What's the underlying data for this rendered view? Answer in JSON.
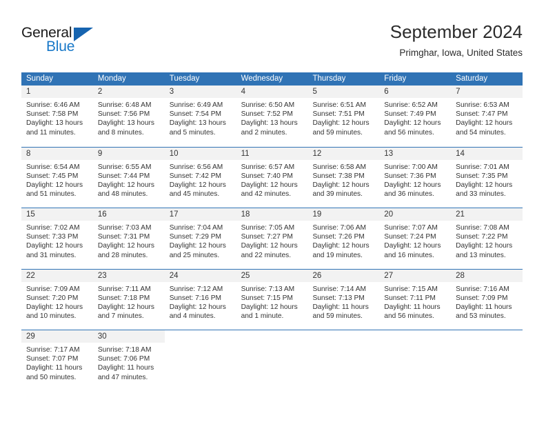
{
  "brand": {
    "name_line1": "General",
    "name_line2": "Blue",
    "triangle_color": "#1664b0",
    "blue_text_color": "#1878c8"
  },
  "header": {
    "title": "September 2024",
    "subtitle": "Primghar, Iowa, United States"
  },
  "theme": {
    "header_blue": "#3073b5",
    "daynum_band": "#f2f2f2",
    "text": "#333333"
  },
  "weekdays": [
    "Sunday",
    "Monday",
    "Tuesday",
    "Wednesday",
    "Thursday",
    "Friday",
    "Saturday"
  ],
  "weeks": [
    [
      {
        "day": "1",
        "sunrise": "Sunrise: 6:46 AM",
        "sunset": "Sunset: 7:58 PM",
        "daylight1": "Daylight: 13 hours",
        "daylight2": "and 11 minutes."
      },
      {
        "day": "2",
        "sunrise": "Sunrise: 6:48 AM",
        "sunset": "Sunset: 7:56 PM",
        "daylight1": "Daylight: 13 hours",
        "daylight2": "and 8 minutes."
      },
      {
        "day": "3",
        "sunrise": "Sunrise: 6:49 AM",
        "sunset": "Sunset: 7:54 PM",
        "daylight1": "Daylight: 13 hours",
        "daylight2": "and 5 minutes."
      },
      {
        "day": "4",
        "sunrise": "Sunrise: 6:50 AM",
        "sunset": "Sunset: 7:52 PM",
        "daylight1": "Daylight: 13 hours",
        "daylight2": "and 2 minutes."
      },
      {
        "day": "5",
        "sunrise": "Sunrise: 6:51 AM",
        "sunset": "Sunset: 7:51 PM",
        "daylight1": "Daylight: 12 hours",
        "daylight2": "and 59 minutes."
      },
      {
        "day": "6",
        "sunrise": "Sunrise: 6:52 AM",
        "sunset": "Sunset: 7:49 PM",
        "daylight1": "Daylight: 12 hours",
        "daylight2": "and 56 minutes."
      },
      {
        "day": "7",
        "sunrise": "Sunrise: 6:53 AM",
        "sunset": "Sunset: 7:47 PM",
        "daylight1": "Daylight: 12 hours",
        "daylight2": "and 54 minutes."
      }
    ],
    [
      {
        "day": "8",
        "sunrise": "Sunrise: 6:54 AM",
        "sunset": "Sunset: 7:45 PM",
        "daylight1": "Daylight: 12 hours",
        "daylight2": "and 51 minutes."
      },
      {
        "day": "9",
        "sunrise": "Sunrise: 6:55 AM",
        "sunset": "Sunset: 7:44 PM",
        "daylight1": "Daylight: 12 hours",
        "daylight2": "and 48 minutes."
      },
      {
        "day": "10",
        "sunrise": "Sunrise: 6:56 AM",
        "sunset": "Sunset: 7:42 PM",
        "daylight1": "Daylight: 12 hours",
        "daylight2": "and 45 minutes."
      },
      {
        "day": "11",
        "sunrise": "Sunrise: 6:57 AM",
        "sunset": "Sunset: 7:40 PM",
        "daylight1": "Daylight: 12 hours",
        "daylight2": "and 42 minutes."
      },
      {
        "day": "12",
        "sunrise": "Sunrise: 6:58 AM",
        "sunset": "Sunset: 7:38 PM",
        "daylight1": "Daylight: 12 hours",
        "daylight2": "and 39 minutes."
      },
      {
        "day": "13",
        "sunrise": "Sunrise: 7:00 AM",
        "sunset": "Sunset: 7:36 PM",
        "daylight1": "Daylight: 12 hours",
        "daylight2": "and 36 minutes."
      },
      {
        "day": "14",
        "sunrise": "Sunrise: 7:01 AM",
        "sunset": "Sunset: 7:35 PM",
        "daylight1": "Daylight: 12 hours",
        "daylight2": "and 33 minutes."
      }
    ],
    [
      {
        "day": "15",
        "sunrise": "Sunrise: 7:02 AM",
        "sunset": "Sunset: 7:33 PM",
        "daylight1": "Daylight: 12 hours",
        "daylight2": "and 31 minutes."
      },
      {
        "day": "16",
        "sunrise": "Sunrise: 7:03 AM",
        "sunset": "Sunset: 7:31 PM",
        "daylight1": "Daylight: 12 hours",
        "daylight2": "and 28 minutes."
      },
      {
        "day": "17",
        "sunrise": "Sunrise: 7:04 AM",
        "sunset": "Sunset: 7:29 PM",
        "daylight1": "Daylight: 12 hours",
        "daylight2": "and 25 minutes."
      },
      {
        "day": "18",
        "sunrise": "Sunrise: 7:05 AM",
        "sunset": "Sunset: 7:27 PM",
        "daylight1": "Daylight: 12 hours",
        "daylight2": "and 22 minutes."
      },
      {
        "day": "19",
        "sunrise": "Sunrise: 7:06 AM",
        "sunset": "Sunset: 7:26 PM",
        "daylight1": "Daylight: 12 hours",
        "daylight2": "and 19 minutes."
      },
      {
        "day": "20",
        "sunrise": "Sunrise: 7:07 AM",
        "sunset": "Sunset: 7:24 PM",
        "daylight1": "Daylight: 12 hours",
        "daylight2": "and 16 minutes."
      },
      {
        "day": "21",
        "sunrise": "Sunrise: 7:08 AM",
        "sunset": "Sunset: 7:22 PM",
        "daylight1": "Daylight: 12 hours",
        "daylight2": "and 13 minutes."
      }
    ],
    [
      {
        "day": "22",
        "sunrise": "Sunrise: 7:09 AM",
        "sunset": "Sunset: 7:20 PM",
        "daylight1": "Daylight: 12 hours",
        "daylight2": "and 10 minutes."
      },
      {
        "day": "23",
        "sunrise": "Sunrise: 7:11 AM",
        "sunset": "Sunset: 7:18 PM",
        "daylight1": "Daylight: 12 hours",
        "daylight2": "and 7 minutes."
      },
      {
        "day": "24",
        "sunrise": "Sunrise: 7:12 AM",
        "sunset": "Sunset: 7:16 PM",
        "daylight1": "Daylight: 12 hours",
        "daylight2": "and 4 minutes."
      },
      {
        "day": "25",
        "sunrise": "Sunrise: 7:13 AM",
        "sunset": "Sunset: 7:15 PM",
        "daylight1": "Daylight: 12 hours",
        "daylight2": "and 1 minute."
      },
      {
        "day": "26",
        "sunrise": "Sunrise: 7:14 AM",
        "sunset": "Sunset: 7:13 PM",
        "daylight1": "Daylight: 11 hours",
        "daylight2": "and 59 minutes."
      },
      {
        "day": "27",
        "sunrise": "Sunrise: 7:15 AM",
        "sunset": "Sunset: 7:11 PM",
        "daylight1": "Daylight: 11 hours",
        "daylight2": "and 56 minutes."
      },
      {
        "day": "28",
        "sunrise": "Sunrise: 7:16 AM",
        "sunset": "Sunset: 7:09 PM",
        "daylight1": "Daylight: 11 hours",
        "daylight2": "and 53 minutes."
      }
    ],
    [
      {
        "day": "29",
        "sunrise": "Sunrise: 7:17 AM",
        "sunset": "Sunset: 7:07 PM",
        "daylight1": "Daylight: 11 hours",
        "daylight2": "and 50 minutes."
      },
      {
        "day": "30",
        "sunrise": "Sunrise: 7:18 AM",
        "sunset": "Sunset: 7:06 PM",
        "daylight1": "Daylight: 11 hours",
        "daylight2": "and 47 minutes."
      },
      {
        "day": "",
        "sunrise": "",
        "sunset": "",
        "daylight1": "",
        "daylight2": ""
      },
      {
        "day": "",
        "sunrise": "",
        "sunset": "",
        "daylight1": "",
        "daylight2": ""
      },
      {
        "day": "",
        "sunrise": "",
        "sunset": "",
        "daylight1": "",
        "daylight2": ""
      },
      {
        "day": "",
        "sunrise": "",
        "sunset": "",
        "daylight1": "",
        "daylight2": ""
      },
      {
        "day": "",
        "sunrise": "",
        "sunset": "",
        "daylight1": "",
        "daylight2": ""
      }
    ]
  ]
}
